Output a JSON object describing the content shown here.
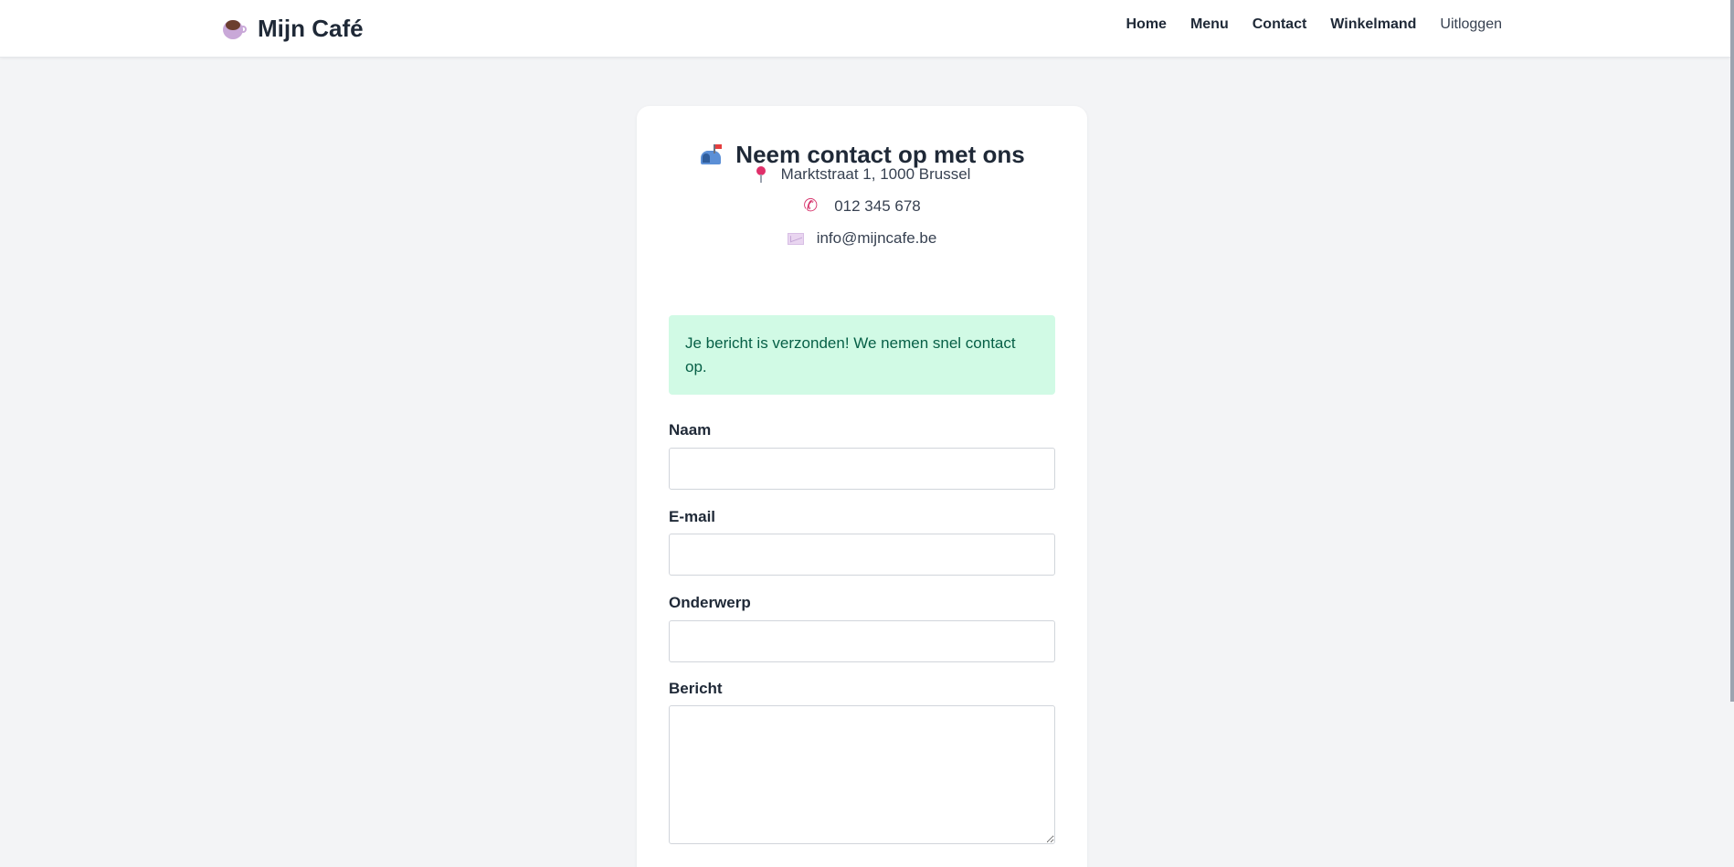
{
  "brand": {
    "name": "Mijn Café",
    "icon": "coffee-cup-icon"
  },
  "nav": {
    "items": [
      {
        "label": "Home"
      },
      {
        "label": "Menu"
      },
      {
        "label": "Contact"
      },
      {
        "label": "Winkelmand"
      },
      {
        "label": "Uitloggen"
      }
    ]
  },
  "contact": {
    "title": "Neem contact op met ons",
    "title_icon": "mailbox-icon",
    "address": "Marktstraat 1, 1000 Brussel",
    "address_icon": "map-pin-icon",
    "phone": "012 345 678",
    "phone_icon": "phone-icon",
    "email": "info@mijncafe.be",
    "email_icon": "envelope-icon",
    "success_message": "Je bericht is verzonden! We nemen snel contact op."
  },
  "form": {
    "name_label": "Naam",
    "name_value": "",
    "email_label": "E-mail",
    "email_value": "",
    "subject_label": "Onderwerp",
    "subject_value": "",
    "message_label": "Bericht",
    "message_value": ""
  },
  "colors": {
    "background": "#f3f4f6",
    "card": "#ffffff",
    "success_bg": "#d1fae5",
    "success_text": "#065f46",
    "text_dark": "#1f2937"
  }
}
